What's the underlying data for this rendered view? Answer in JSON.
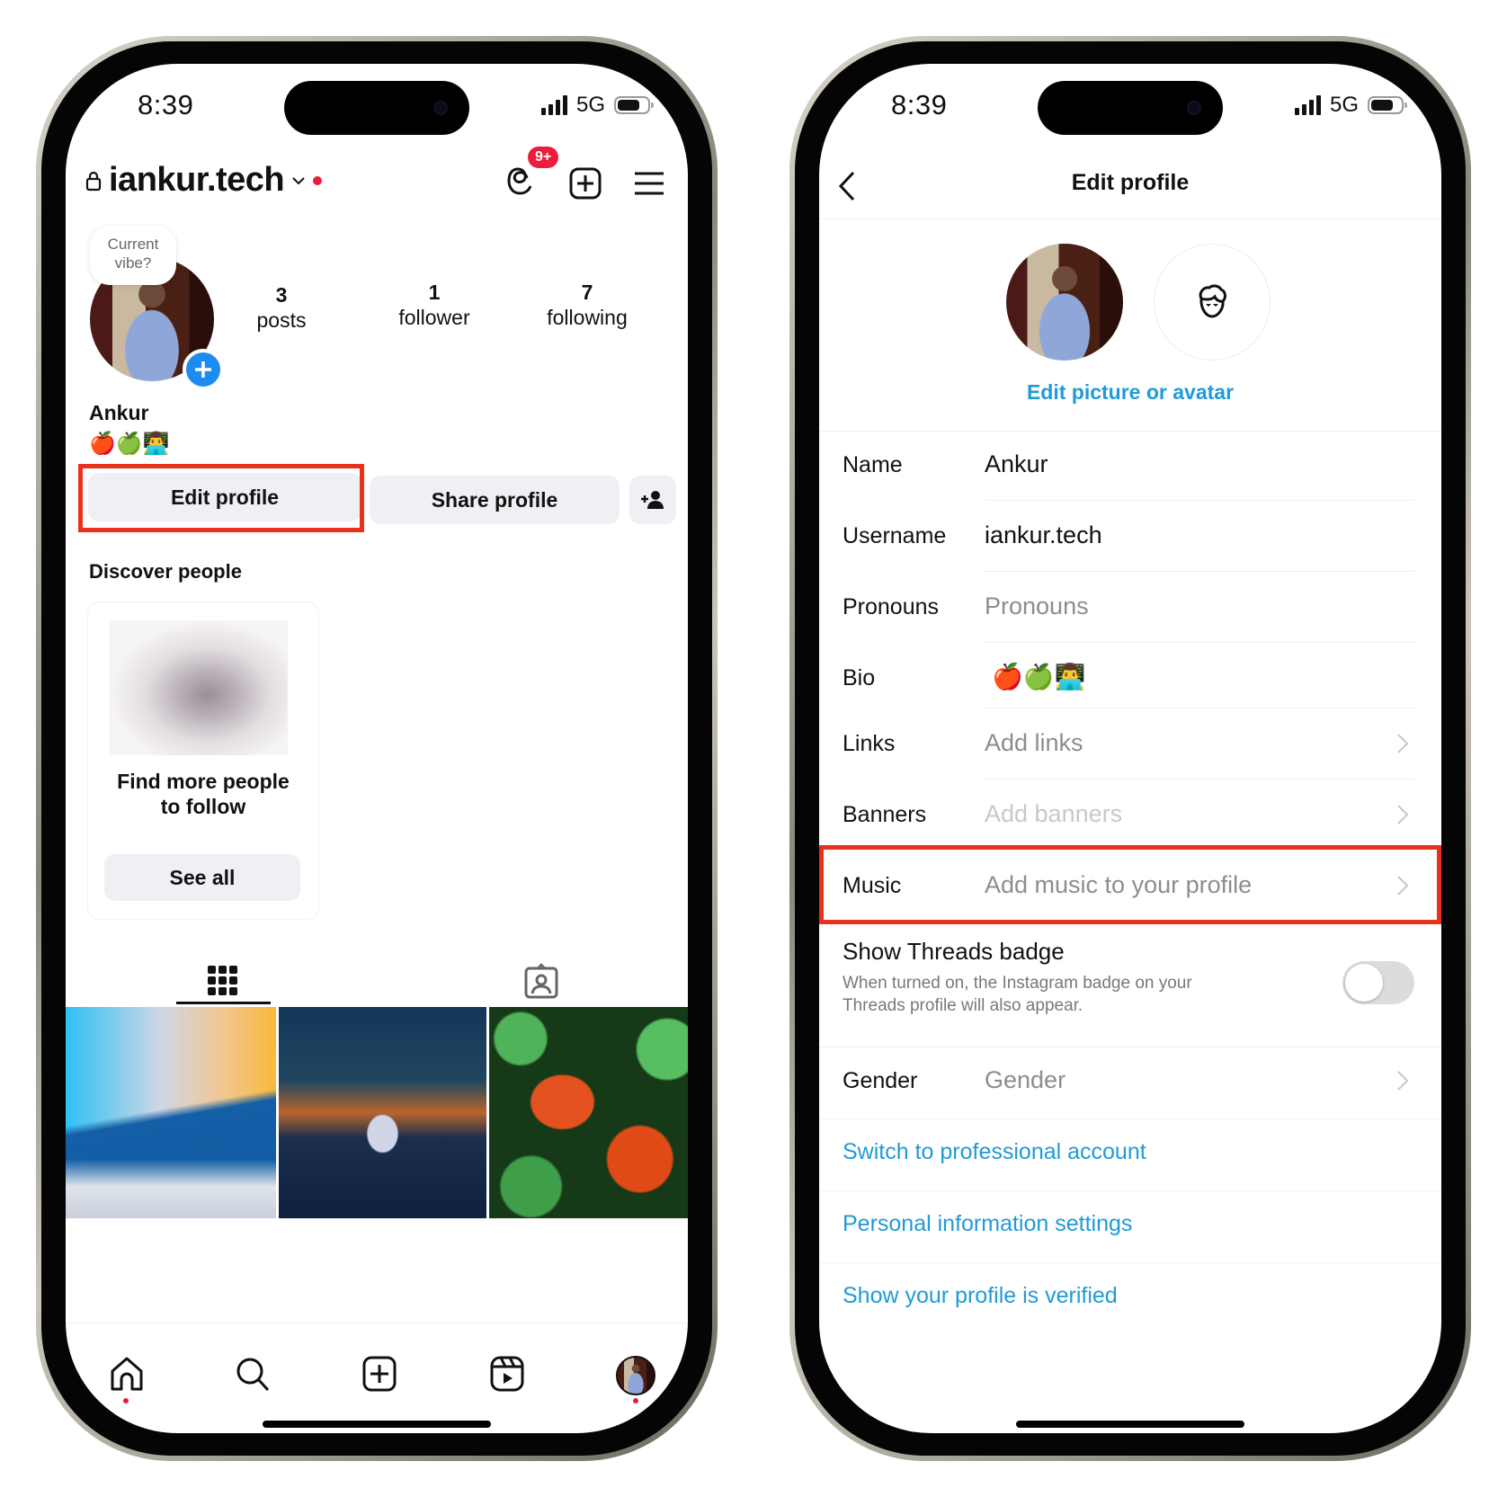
{
  "status_bar": {
    "time": "8:39",
    "network": "5G"
  },
  "profile_screen": {
    "username": "iankur.tech",
    "threads_badge": "9+",
    "note_bubble": {
      "line1": "Current",
      "line2": "vibe?"
    },
    "stats": [
      {
        "count": "3",
        "label": "posts"
      },
      {
        "count": "1",
        "label": "follower"
      },
      {
        "count": "7",
        "label": "following"
      }
    ],
    "display_name": "Ankur",
    "bio": "🍎🍏👨‍💻",
    "edit_profile_button": "Edit profile",
    "share_profile_button": "Share profile",
    "discover_title": "Discover people",
    "discover_card": {
      "text": "Find more people to follow",
      "button": "See all"
    },
    "posts": [
      {
        "name": "mountain-gradient-wallpaper"
      },
      {
        "name": "mount-fuji-dusk"
      },
      {
        "name": "clownfish-anemone"
      }
    ],
    "bottom_nav": [
      "home",
      "search",
      "create",
      "reels",
      "profile"
    ]
  },
  "edit_screen": {
    "title": "Edit profile",
    "edit_picture_link": "Edit picture or avatar",
    "fields": [
      {
        "label": "Name",
        "value": "Ankur",
        "state": "filled"
      },
      {
        "label": "Username",
        "value": "iankur.tech",
        "state": "filled"
      },
      {
        "label": "Pronouns",
        "value": "Pronouns",
        "state": "placeholder"
      },
      {
        "label": "Bio",
        "value": "🍎🍏👨‍💻",
        "state": "filled"
      },
      {
        "label": "Links",
        "value": "Add links",
        "state": "placeholder",
        "chevron": true
      },
      {
        "label": "Banners",
        "value": "Add banners",
        "state": "disabled",
        "chevron": true
      },
      {
        "label": "Music",
        "value": "Add music to your profile",
        "state": "placeholder",
        "chevron": true,
        "highlighted": true
      }
    ],
    "threads_badge": {
      "title": "Show Threads badge",
      "description_line1": "When turned on, the Instagram badge on your",
      "description_line2": "Threads profile will also appear.",
      "enabled": false
    },
    "gender": {
      "label": "Gender",
      "value": "Gender"
    },
    "links": [
      "Switch to professional account",
      "Personal information settings",
      "Show your profile is verified"
    ]
  },
  "colors": {
    "accent_blue": "#1f9bd7",
    "highlight_red": "#e8321e",
    "notification_red": "#ed1c3c",
    "plus_blue": "#1d8cf0"
  }
}
